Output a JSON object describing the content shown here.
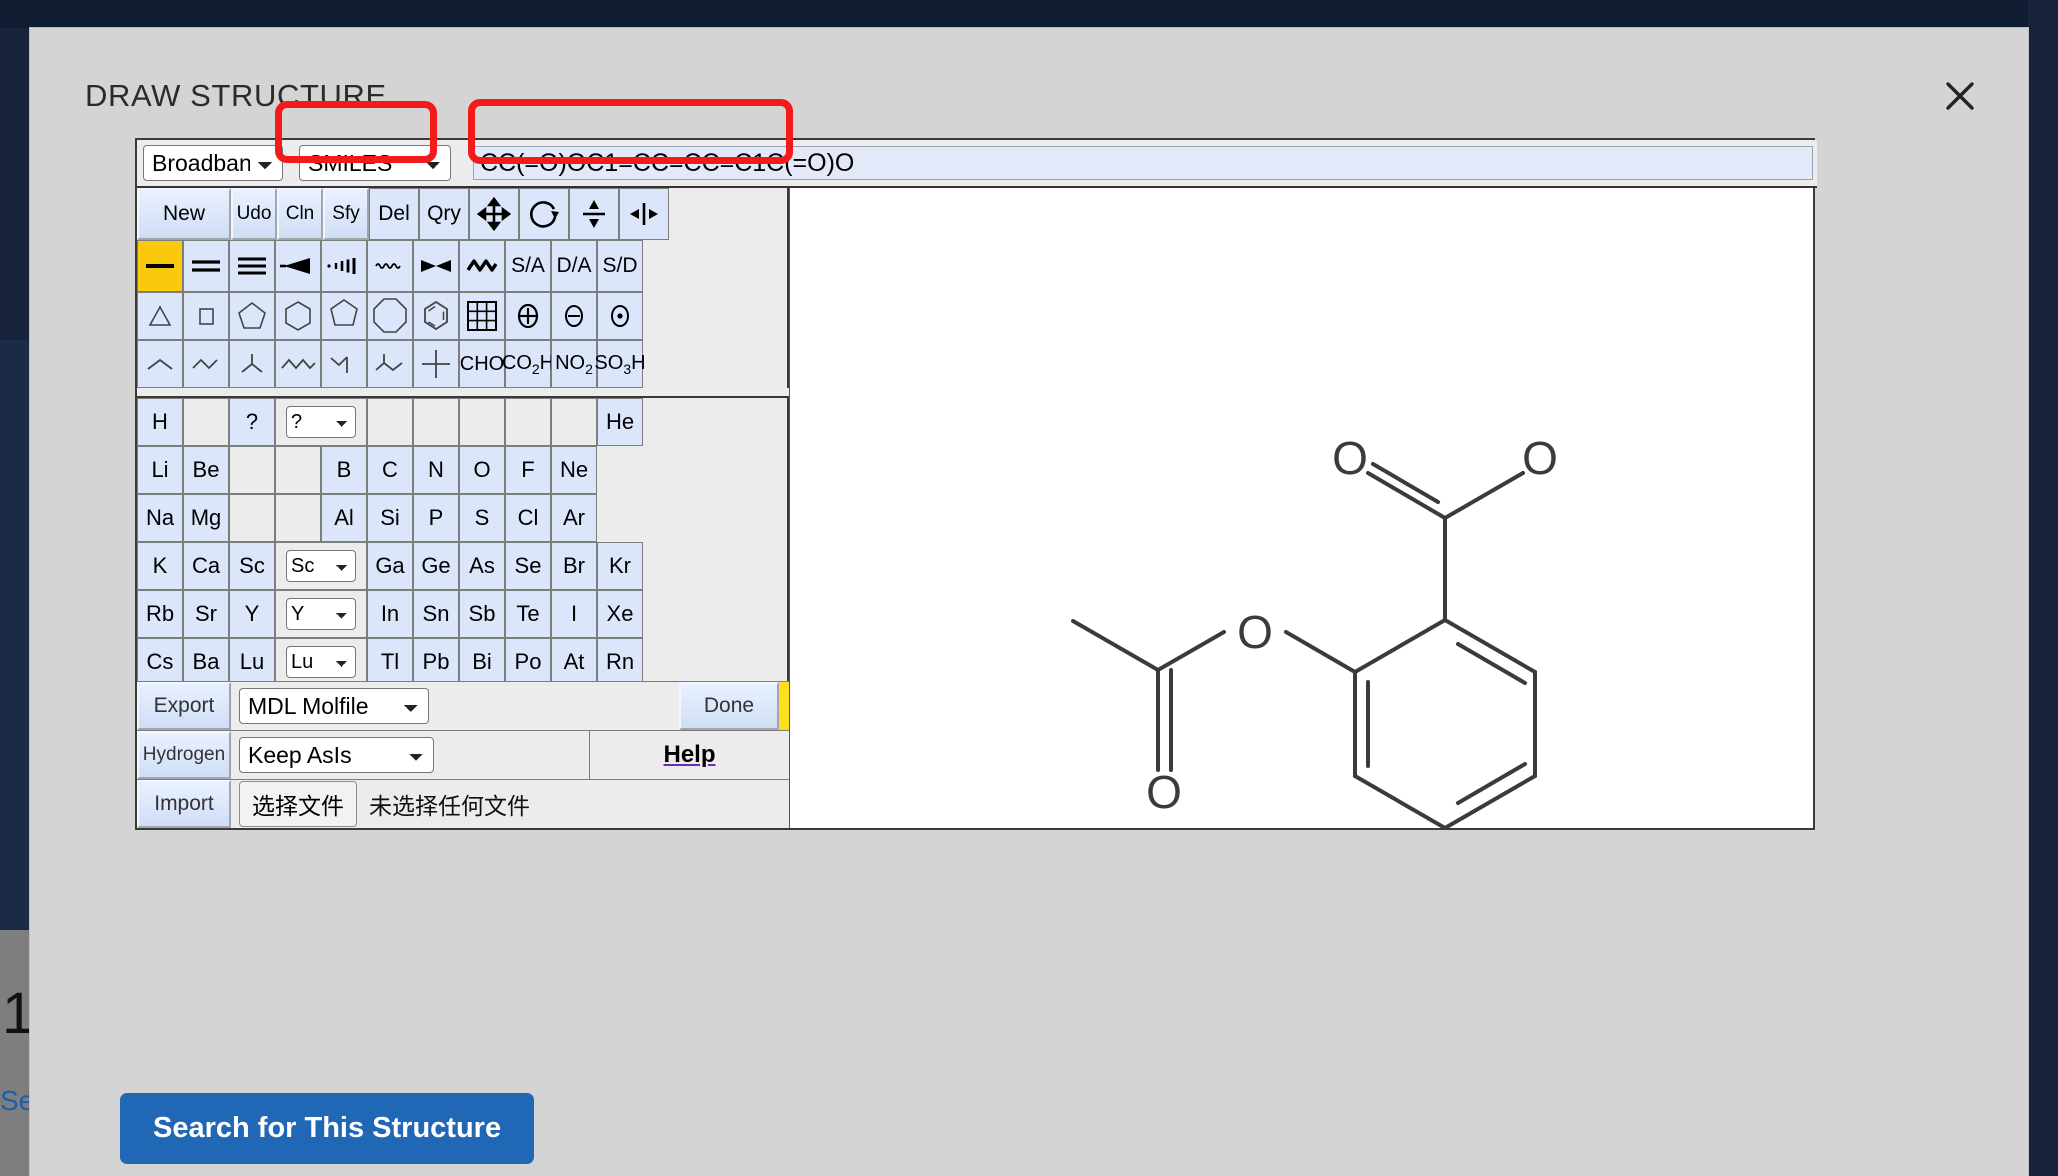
{
  "modal": {
    "title": "DRAW STRUCTURE",
    "close_icon": "close-icon"
  },
  "sketcher": {
    "database_select": {
      "value": "Broadband",
      "options": [
        "Broadband"
      ]
    },
    "format_select": {
      "value": "SMILES",
      "options": [
        "SMILES"
      ]
    },
    "structure_input": {
      "value": "CC(=O)OC1=CC=CC=C1C(=O)O",
      "placeholder": ""
    },
    "toolbar": [
      {
        "label": "New",
        "name": "new-button"
      },
      {
        "label": "Udo",
        "name": "undo-button"
      },
      {
        "label": "Cln",
        "name": "clean-button"
      },
      {
        "label": "Sfy",
        "name": "stereo-button"
      },
      {
        "label": "Del",
        "name": "delete-button"
      },
      {
        "label": "Qry",
        "name": "query-button"
      },
      {
        "label": "",
        "name": "move-icon"
      },
      {
        "label": "",
        "name": "rotate-icon"
      },
      {
        "label": "",
        "name": "flip-vertical-icon"
      },
      {
        "label": "",
        "name": "flip-horizontal-icon"
      }
    ],
    "bond_tools": [
      {
        "label": "",
        "name": "single-bond-icon",
        "selected": true
      },
      {
        "label": "",
        "name": "double-bond-icon",
        "selected": false
      },
      {
        "label": "",
        "name": "triple-bond-icon",
        "selected": false
      },
      {
        "label": "",
        "name": "wedge-bond-icon",
        "selected": false
      },
      {
        "label": "",
        "name": "hash-bond-icon",
        "selected": false
      },
      {
        "label": "",
        "name": "wavy-bond-icon",
        "selected": false
      },
      {
        "label": "",
        "name": "crossed-bond-icon",
        "selected": false
      },
      {
        "label": "",
        "name": "chain-bond-icon",
        "selected": false
      },
      {
        "label": "S/A",
        "name": "single-aromatic-button",
        "selected": false
      },
      {
        "label": "D/A",
        "name": "double-aromatic-button",
        "selected": false
      },
      {
        "label": "S/D",
        "name": "single-double-button",
        "selected": false
      }
    ],
    "ring_tools": [
      {
        "label": "",
        "name": "cyclopropane-icon"
      },
      {
        "label": "",
        "name": "cyclobutane-icon"
      },
      {
        "label": "",
        "name": "cyclopentane-icon"
      },
      {
        "label": "",
        "name": "cyclohexane-icon"
      },
      {
        "label": "",
        "name": "cycloheptane-icon"
      },
      {
        "label": "",
        "name": "cyclooctane-icon"
      },
      {
        "label": "",
        "name": "benzene-icon"
      },
      {
        "label": "",
        "name": "template-table-icon"
      },
      {
        "label": "",
        "name": "positive-charge-icon"
      },
      {
        "label": "",
        "name": "negative-charge-icon"
      },
      {
        "label": "",
        "name": "radical-icon"
      }
    ],
    "chain_tools": [
      {
        "label": "",
        "name": "chain-2-icon"
      },
      {
        "label": "",
        "name": "chain-3-icon"
      },
      {
        "label": "",
        "name": "isopropyl-icon"
      },
      {
        "label": "",
        "name": "chain-5-icon"
      },
      {
        "label": "",
        "name": "isobutyl-icon"
      },
      {
        "label": "",
        "name": "branched-chain-icon"
      },
      {
        "label": "",
        "name": "tert-butyl-icon"
      },
      {
        "label": "CHO",
        "name": "cho-group-button"
      },
      {
        "label": "CO2H",
        "name": "co2h-group-button"
      },
      {
        "label": "NO2",
        "name": "no2-group-button"
      },
      {
        "label": "SO3H",
        "name": "so3h-group-button"
      }
    ],
    "periodic_table": [
      [
        "H",
        "",
        "?",
        "SELECT:any",
        "",
        "",
        "",
        "",
        "",
        "He"
      ],
      [
        "Li",
        "Be",
        "",
        "",
        "B",
        "C",
        "N",
        "O",
        "F",
        "Ne"
      ],
      [
        "Na",
        "Mg",
        "",
        "",
        "Al",
        "Si",
        "P",
        "S",
        "Cl",
        "Ar"
      ],
      [
        "K",
        "Ca",
        "Sc",
        "SELECT:sc",
        "Ga",
        "Ge",
        "As",
        "Se",
        "Br",
        "Kr"
      ],
      [
        "Rb",
        "Sr",
        "Y",
        "SELECT:y",
        "In",
        "Sn",
        "Sb",
        "Te",
        "I",
        "Xe"
      ],
      [
        "Cs",
        "Ba",
        "Lu",
        "SELECT:lu",
        "Tl",
        "Pb",
        "Bi",
        "Po",
        "At",
        "Rn"
      ]
    ],
    "any_atom_select": {
      "value": "?",
      "options": [
        "?"
      ]
    },
    "sc_select": {
      "value": "Sc",
      "options": [
        "Sc"
      ]
    },
    "y_select": {
      "value": "Y",
      "options": [
        "Y"
      ]
    },
    "lu_select": {
      "value": "Lu",
      "options": [
        "Lu"
      ]
    },
    "export_label": "Export",
    "export_select": {
      "value": "MDL Molfile",
      "options": [
        "MDL Molfile"
      ]
    },
    "done_label": "Done",
    "hydrogen_label": "Hydrogen",
    "hydrogen_select": {
      "value": "Keep AsIs",
      "options": [
        "Keep AsIs"
      ]
    },
    "help_label": "Help",
    "import_label": "Import",
    "file_button_label": "选择文件",
    "file_status_label": "未选择任何文件"
  },
  "actions": {
    "search_button": "Search for This Structure"
  },
  "structure": {
    "name": "aspirin",
    "smiles": "CC(=O)OC1=CC=CC=C1C(=O)O",
    "atom_labels": [
      "O",
      "O",
      "O",
      "O"
    ]
  },
  "colors": {
    "accent": "#2067b5",
    "annotation": "#f21a1a",
    "selected_tool": "#fbc90c",
    "modal_bg": "#d4d4d4",
    "page_bg": "#16233a",
    "button_face": "#dbe6fa",
    "input_bg": "#e3e9f8"
  }
}
